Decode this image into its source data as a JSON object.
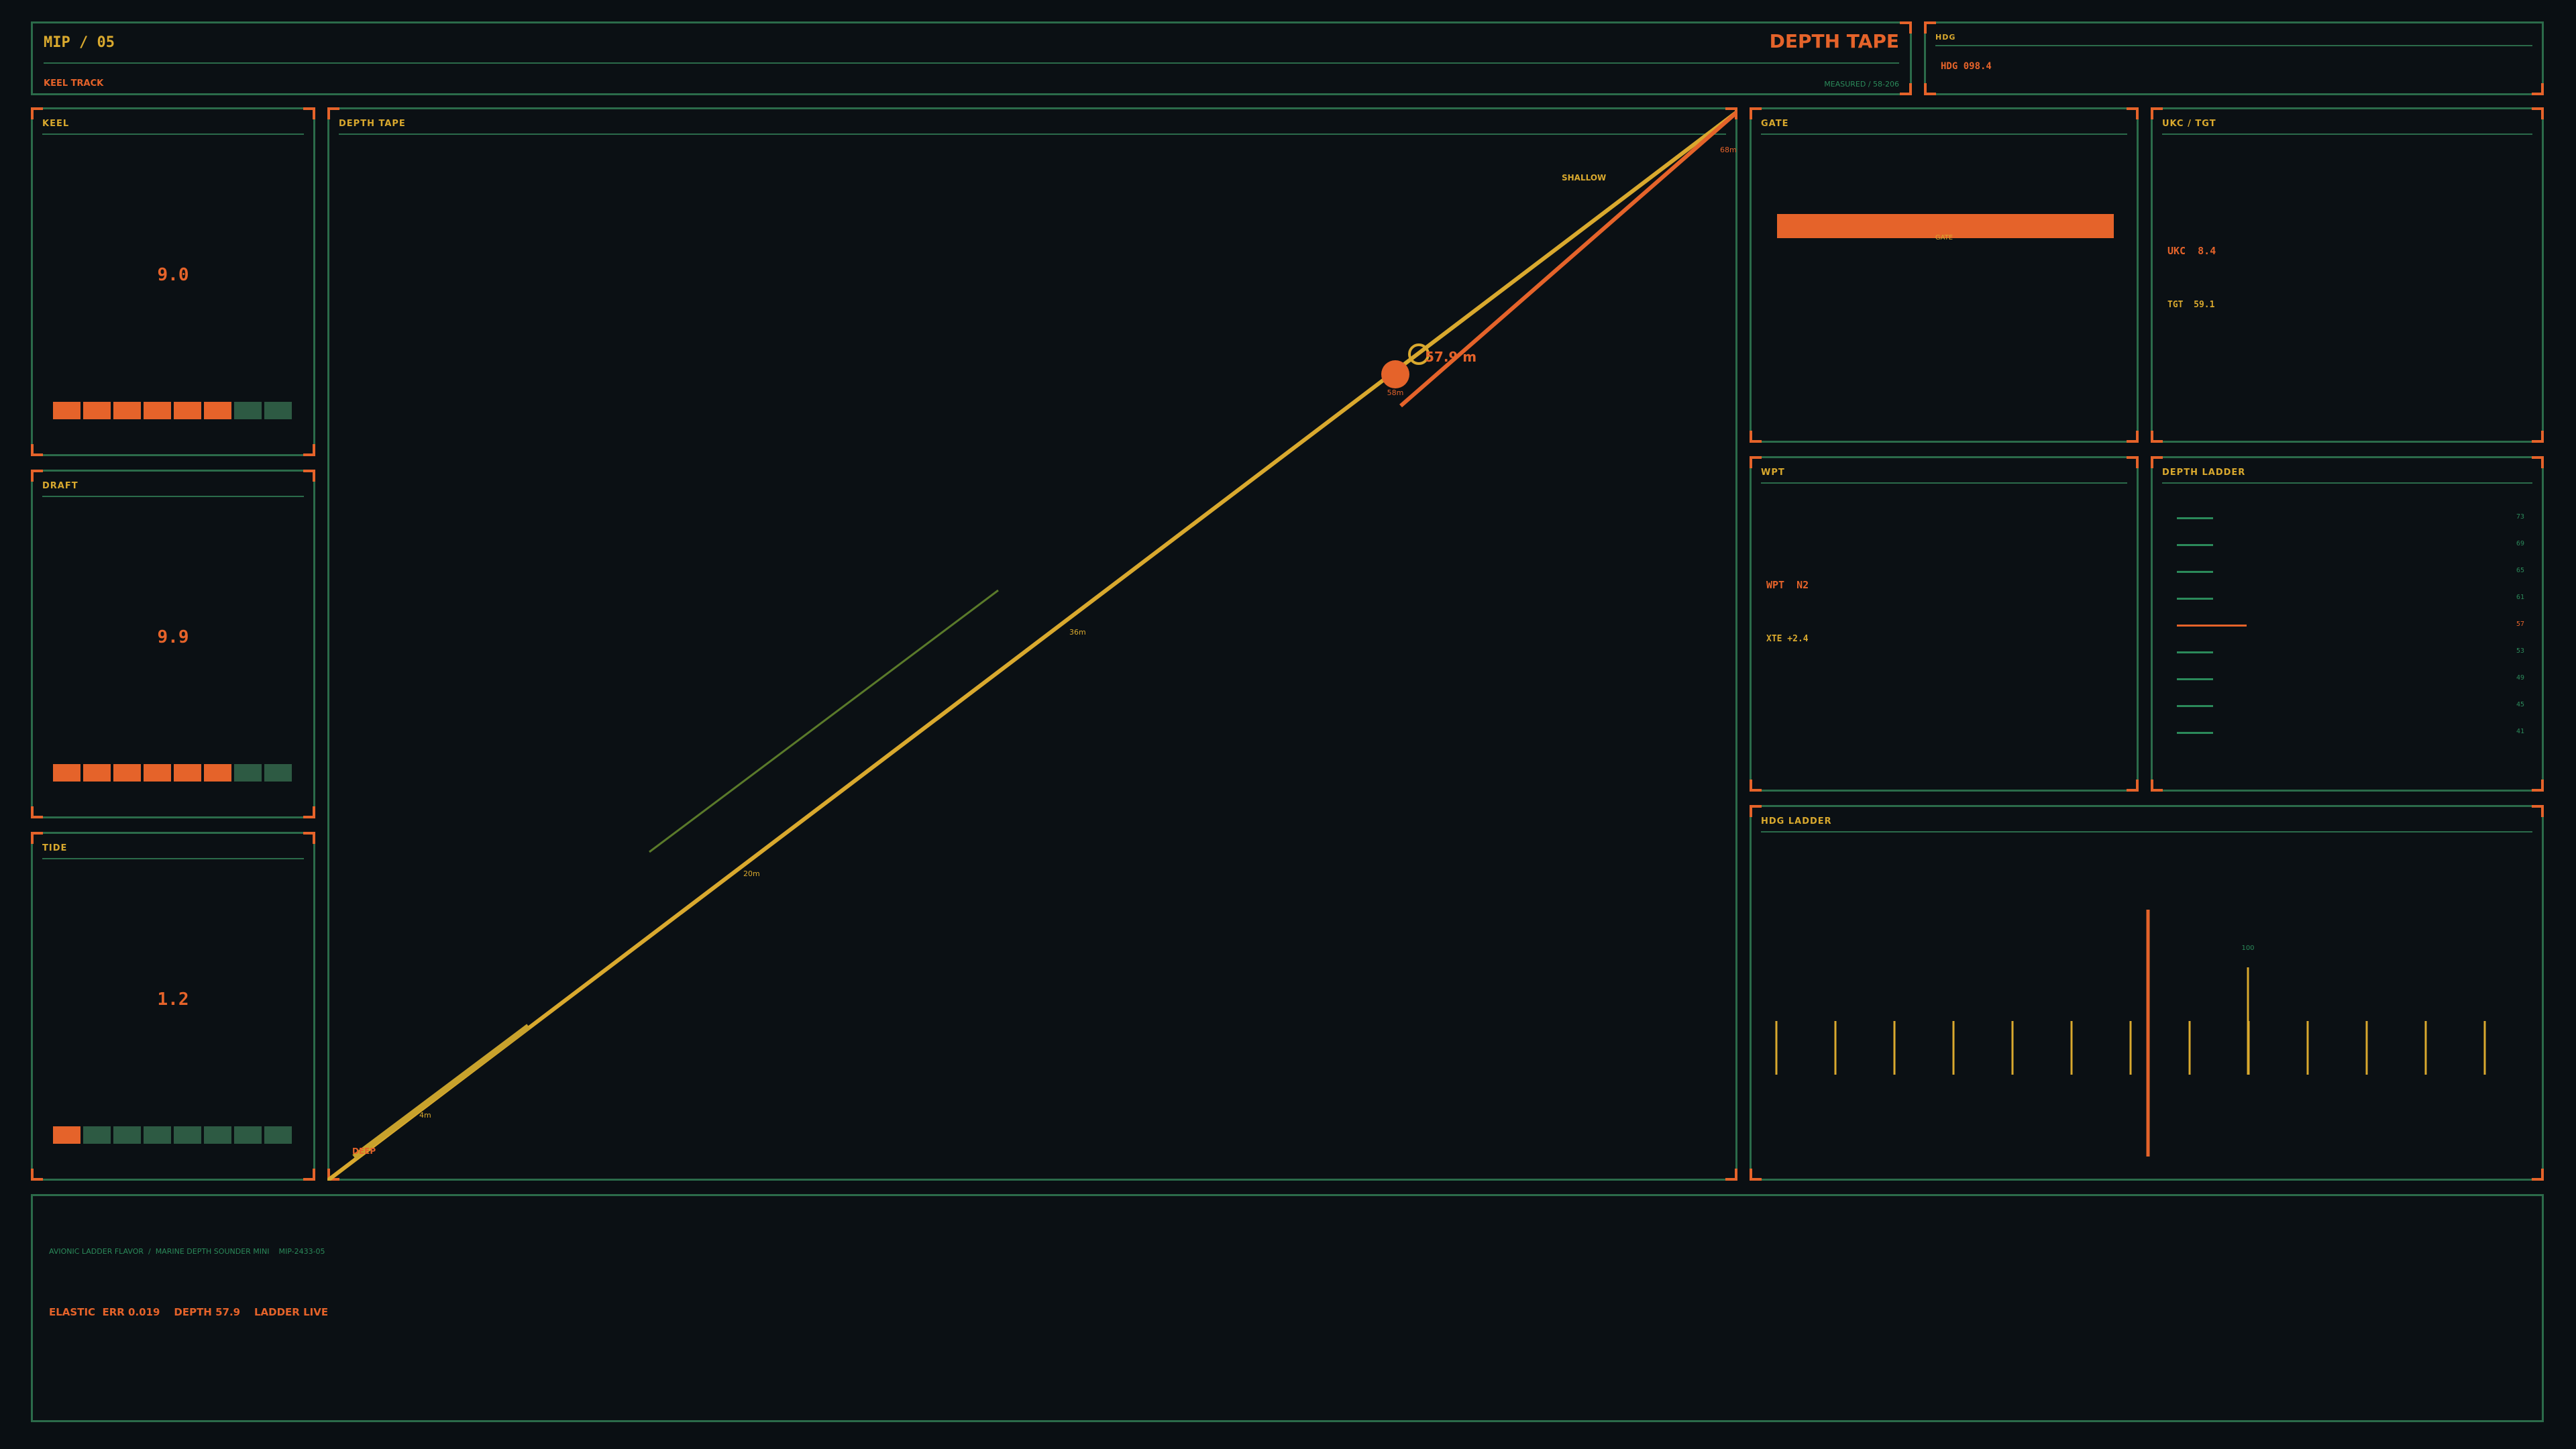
{
  "header": {
    "id": "MIP / 05",
    "title": "DEPTH TAPE",
    "subtitle": "KEEL TRACK",
    "measured": "MEASURED / 58-206"
  },
  "hdg_panel": {
    "title": "HDG",
    "value": "HDG 098.4"
  },
  "keel": {
    "title": "KEEL",
    "value": "9.0",
    "segments_on": 6,
    "segments_total": 8
  },
  "draft": {
    "title": "DRAFT",
    "value": "9.9",
    "segments_on": 6,
    "segments_total": 8
  },
  "tide": {
    "title": "TIDE",
    "value": "1.2",
    "segments_on": 1,
    "segments_total": 8
  },
  "depth_tape": {
    "title": "DEPTH TAPE",
    "shallow_label": "SHALLOW",
    "deep_label": "DEEP",
    "readout": "57.9 m",
    "marker_label": "58m",
    "scale_labels": [
      "4m",
      "20m",
      "36m",
      "68m"
    ]
  },
  "gate": {
    "title": "GATE",
    "bar_label": "GATE",
    "fill": 1.0
  },
  "ukc_tgt": {
    "title": "UKC / TGT",
    "ukc": "UKC  8.4",
    "tgt": "TGT  59.1"
  },
  "wpt": {
    "title": "WPT",
    "wpt": "WPT  N2",
    "xte": "XTE +2.4"
  },
  "depth_ladder": {
    "title": "DEPTH LADDER",
    "values": [
      "73",
      "69",
      "65",
      "61",
      "57",
      "53",
      "49",
      "45",
      "41"
    ],
    "active_index": 4
  },
  "hdg_ladder": {
    "title": "HDG LADDER",
    "peak_label": "100"
  },
  "footer": {
    "meta": "AVIONIC LADDER FLAVOR  /  MARINE DEPTH SOUNDER MINI    MIP-2433-05",
    "status": "ELASTIC  ERR 0.019    DEPTH 57.9    LADDER LIVE"
  },
  "colors": {
    "accent": "#e5632a",
    "secondary": "#d9a92e",
    "frame": "#2b6b4a",
    "background": "#0a0f13"
  }
}
